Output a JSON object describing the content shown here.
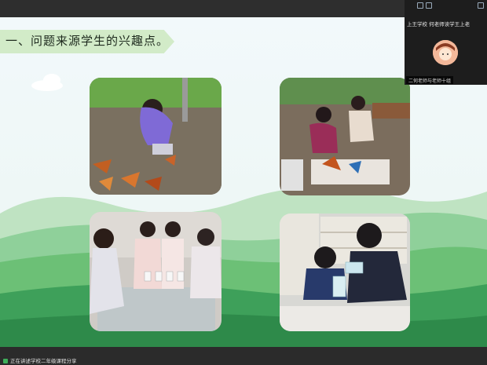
{
  "slide": {
    "title": "一、问题来源学生的兴趣点。",
    "photos": [
      {
        "icon": "girl-collecting-leaves-photo"
      },
      {
        "icon": "girls-arranging-leaves-photo"
      },
      {
        "icon": "students-water-experiment-photo"
      },
      {
        "icon": "boys-pouring-water-photo"
      }
    ]
  },
  "meeting": {
    "participant_name": "上王学校 何老师读学王上老",
    "participant_tag": "二何老师与老师十组",
    "status_label": "正在讲述学校二年级课程分享"
  },
  "colors": {
    "title_ribbon": "#d2ebc8",
    "hill_dark": "#2e8a4a",
    "hill_light": "#6cc076"
  }
}
